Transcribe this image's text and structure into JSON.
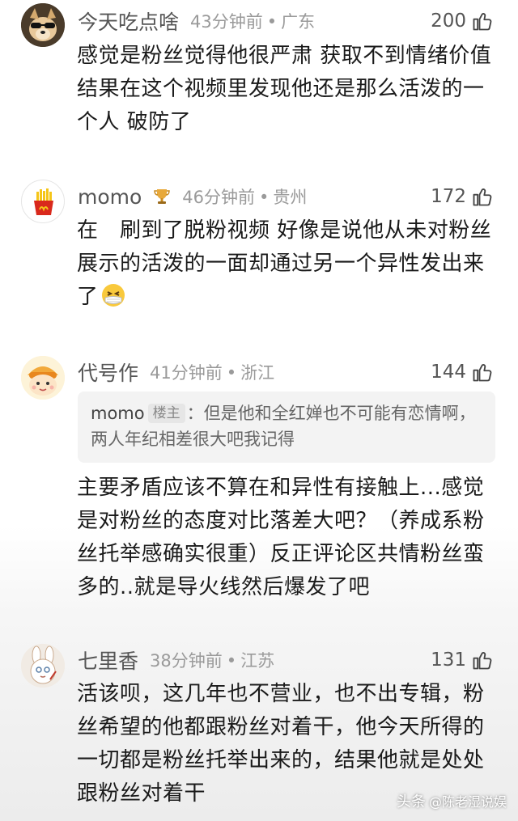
{
  "comments": [
    {
      "username": "今天吃点啥",
      "time": "43分钟前",
      "location": "广东",
      "likes": "200",
      "text": "感觉是粉丝觉得他很严肃 获取不到情绪价值 结果在这个视频里发现他还是那么活泼的一个人 破防了",
      "avatar_icon": "dog-with-sunglasses-avatar"
    },
    {
      "username": "momo",
      "badge_icon": "trophy-icon",
      "time": "46分钟前",
      "location": "贵州",
      "likes": "172",
      "text": "在　刷到了脱粉视频 好像是说他从未对粉丝展示的活泼的一面却通过另一个异性发出来了",
      "emoji_icon": "sick-face-emoji",
      "avatar_icon": "french-fries-avatar"
    },
    {
      "username": "代号作",
      "time": "41分钟前",
      "location": "浙江",
      "likes": "144",
      "quote": {
        "name": "momo",
        "op_tag": "楼主",
        "text": "：但是他和全红婵也不可能有恋情啊，两人年纪相差很大吧我记得"
      },
      "text": "主要矛盾应该不算在和异性有接触上...感觉是对粉丝的态度对比落差大吧？（养成系粉丝托举感确实很重）反正评论区共情粉丝蛮多的..就是导火线然后爆发了吧",
      "avatar_icon": "cartoon-character-avatar"
    },
    {
      "username": "七里香",
      "time": "38分钟前",
      "location": "江苏",
      "likes": "131",
      "text": "活该呗，这几年也不营业，也不出专辑，粉丝希望的他都跟粉丝对着干，他今天所得的一切都是粉丝托举出来的，结果他就是处处跟粉丝对着干",
      "avatar_icon": "cartoon-rabbit-avatar"
    }
  ],
  "separator": "•",
  "watermark": {
    "brand": "头条",
    "handle": "@陈老湿说娱"
  },
  "colors": {
    "username": "#555555",
    "time": "#9a9a9a",
    "text": "#1a1a1a",
    "quote_bg": "#f3f3f3"
  }
}
